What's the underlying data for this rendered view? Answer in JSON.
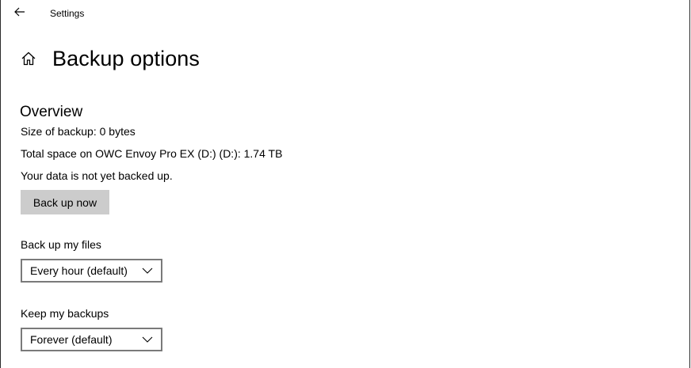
{
  "app": {
    "title": "Settings"
  },
  "header": {
    "title": "Backup options"
  },
  "overview": {
    "section_title": "Overview",
    "size_of_backup": "Size of backup: 0 bytes",
    "total_space": "Total space on OWC Envoy Pro EX (D:) (D:): 1.74 TB",
    "status": "Your data is not yet backed up.",
    "back_up_now_label": "Back up now"
  },
  "backup_frequency": {
    "label": "Back up my files",
    "selected": "Every hour (default)"
  },
  "keep_backups": {
    "label": "Keep my backups",
    "selected": "Forever (default)"
  },
  "icons": {
    "back": "back-arrow-icon",
    "home": "home-icon",
    "dropdown": "chevron-down-icon"
  },
  "colors": {
    "button_bg": "#cccccc",
    "dropdown_border": "#7a7a7a",
    "window_border": "#2b2b2b"
  }
}
